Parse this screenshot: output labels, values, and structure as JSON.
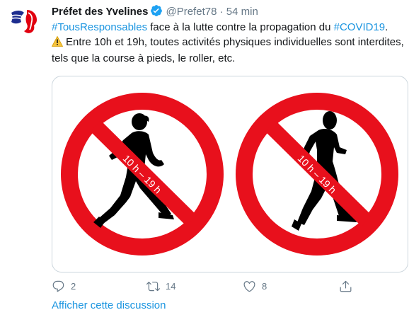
{
  "tweet": {
    "author": {
      "display_name": "Préfet des Yvelines",
      "handle": "@Prefet78",
      "verified": true
    },
    "separator": "·",
    "timestamp": "54 min",
    "text": {
      "hashtag1": "#TousResponsables",
      "segment1": " face à la lutte contre la propagation du ",
      "hashtag2": "#COVID19",
      "segment2": ".",
      "line2": "Entre 10h et 19h, toutes activités physiques individuelles sont interdites, tels que la course à pieds, le roller, etc."
    },
    "media": {
      "sign_left_label": "10 h – 19 h",
      "sign_right_label": "10 h – 19 h"
    },
    "actions": {
      "reply_count": "2",
      "retweet_count": "14",
      "like_count": "8"
    },
    "show_thread": "Afficher cette discussion"
  },
  "colors": {
    "link": "#1b95e0",
    "muted": "#657786",
    "sign_red": "#e8101c",
    "verified": "#1da1f2"
  },
  "icons": {
    "verified": "verified-badge-icon",
    "warning": "warning-sign-icon",
    "reply": "reply-icon",
    "retweet": "retweet-icon",
    "like": "heart-icon",
    "share": "share-icon"
  }
}
